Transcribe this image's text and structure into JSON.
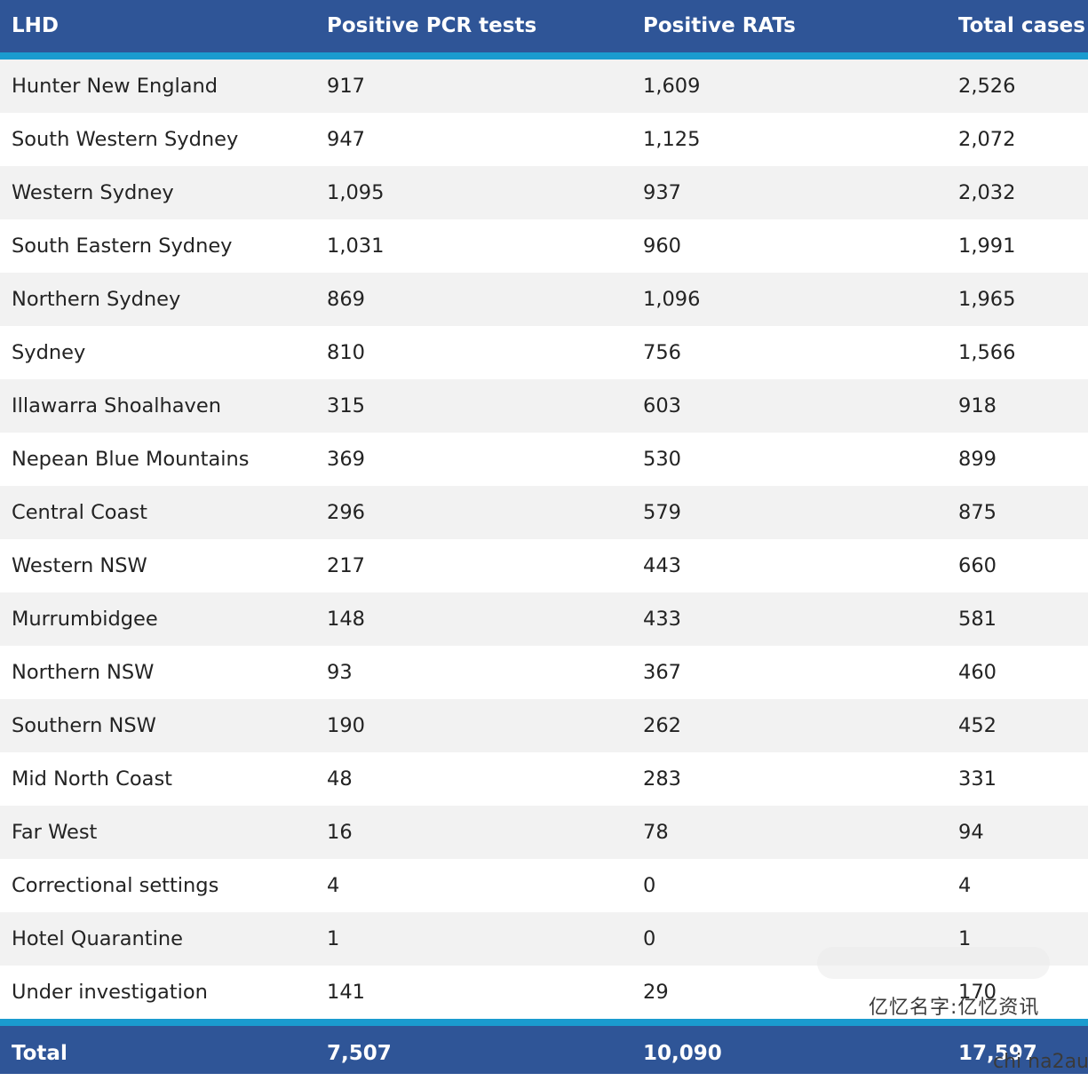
{
  "table": {
    "headers": [
      "LHD",
      "Positive PCR tests",
      "Positive RATs",
      "Total cases"
    ],
    "rows": [
      [
        "Hunter New England",
        "917",
        "1,609",
        "2,526"
      ],
      [
        "South Western Sydney",
        "947",
        "1,125",
        "2,072"
      ],
      [
        "Western Sydney",
        "1,095",
        "937",
        "2,032"
      ],
      [
        "South Eastern Sydney",
        "1,031",
        "960",
        "1,991"
      ],
      [
        "Northern Sydney",
        "869",
        "1,096",
        "1,965"
      ],
      [
        "Sydney",
        "810",
        "756",
        "1,566"
      ],
      [
        "Illawarra Shoalhaven",
        "315",
        "603",
        "918"
      ],
      [
        "Nepean Blue Mountains",
        "369",
        "530",
        "899"
      ],
      [
        "Central Coast",
        "296",
        "579",
        "875"
      ],
      [
        "Western NSW",
        "217",
        "443",
        "660"
      ],
      [
        "Murrumbidgee",
        "148",
        "433",
        "581"
      ],
      [
        "Northern NSW",
        "93",
        "367",
        "460"
      ],
      [
        "Southern NSW",
        "190",
        "262",
        "452"
      ],
      [
        "Mid North Coast",
        "48",
        "283",
        "331"
      ],
      [
        "Far West",
        "16",
        "78",
        "94"
      ],
      [
        "Correctional settings",
        "4",
        "0",
        "4"
      ],
      [
        "Hotel Quarantine",
        "1",
        "0",
        "1"
      ],
      [
        "Under investigation",
        "141",
        "29",
        "170"
      ]
    ],
    "footer": [
      "Total",
      "7,507",
      "10,090",
      "17,597"
    ]
  },
  "watermark": {
    "line1": "亿忆名字:亿忆资讯",
    "line2": "chi na2au"
  },
  "colors": {
    "header_bg": "#2f5597",
    "header_rule": "#1a9bcf",
    "row_alt": "#f2f2f2"
  }
}
